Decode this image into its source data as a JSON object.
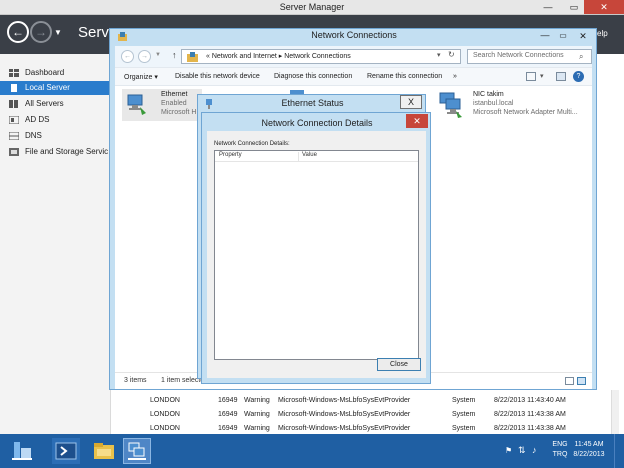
{
  "server_manager": {
    "title": "Server Manager",
    "nav_title": "Server",
    "help_label": "elp",
    "sidebar": {
      "items": [
        {
          "label": "Dashboard",
          "active": false
        },
        {
          "label": "Local Server",
          "active": true
        },
        {
          "label": "All Servers",
          "active": false
        },
        {
          "label": "AD DS",
          "active": false
        },
        {
          "label": "DNS",
          "active": false
        },
        {
          "label": "File and Storage Servic",
          "active": false
        }
      ]
    },
    "events": [
      {
        "server": "LONDON",
        "id": "16949",
        "severity": "Warning",
        "source": "Microsoft-Windows-MsLbfoSysEvtProvider",
        "log": "System",
        "date": "8/22/2013 11:43:40 AM"
      },
      {
        "server": "LONDON",
        "id": "16949",
        "severity": "Warning",
        "source": "Microsoft-Windows-MsLbfoSysEvtProvider",
        "log": "System",
        "date": "8/22/2013 11:43:38 AM"
      },
      {
        "server": "LONDON",
        "id": "16949",
        "severity": "Warning",
        "source": "Microsoft-Windows-MsLbfoSysEvtProvider",
        "log": "System",
        "date": "8/22/2013 11:43:38 AM"
      }
    ]
  },
  "network_connections": {
    "title": "Network Connections",
    "breadcrumb": "«  Network and Internet  ▸  Network Connections",
    "search_placeholder": "Search Network Connections",
    "commands": {
      "organize": "Organize ▾",
      "disable": "Disable this network device",
      "diagnose": "Diagnose this connection",
      "rename": "Rename this connection",
      "more": "»"
    },
    "connections": [
      {
        "name": "Ethernet",
        "status": "Enabled",
        "adapter": "Microsoft H"
      },
      {
        "name": "NIC takim",
        "status": "istanbul.local",
        "adapter": "Microsoft Network Adapter Multi..."
      }
    ],
    "status_bar": {
      "item_count": "3 items",
      "selected": "1 item selecte"
    }
  },
  "ethernet_status": {
    "title": "Ethernet Status",
    "close_glyph": "X"
  },
  "details": {
    "title": "Network Connection Details",
    "label": "Network Connection Details:",
    "columns": [
      "Property",
      "Value"
    ],
    "close_button": "Close"
  },
  "taskbar": {
    "language": "ENG",
    "input_method": "TRQ",
    "time": "11:45 AM",
    "date": "8/22/2013"
  }
}
